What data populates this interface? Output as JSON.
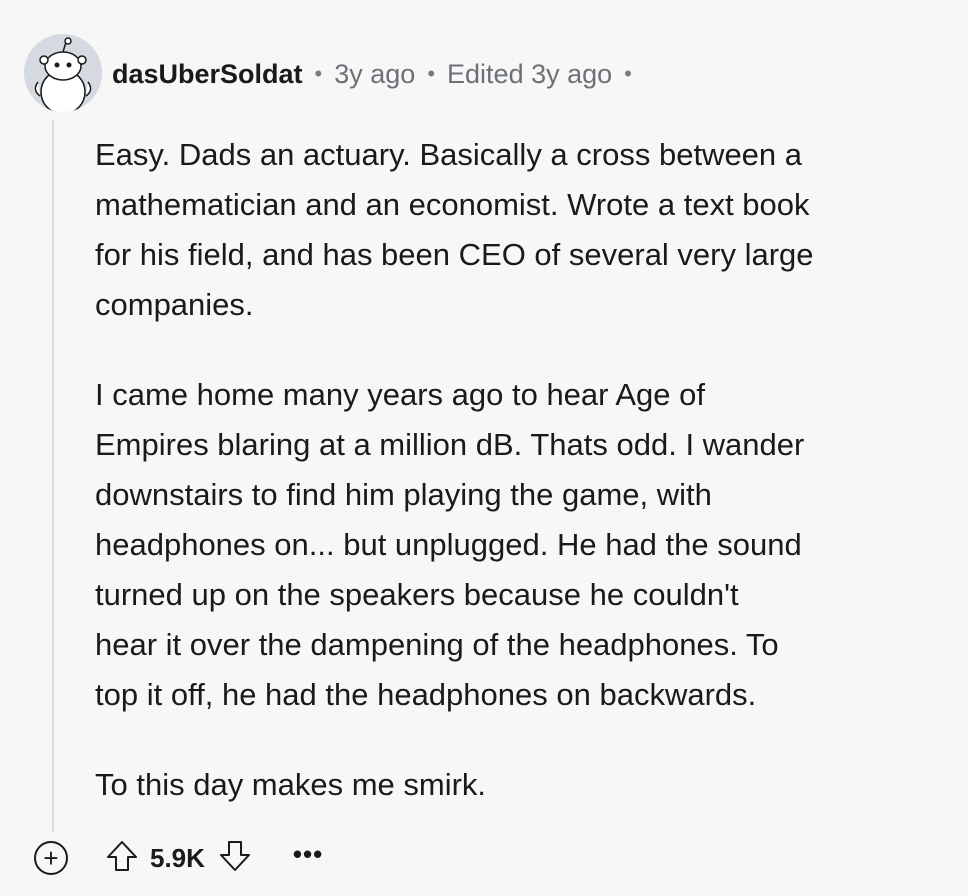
{
  "comment": {
    "username": "dasUberSoldat",
    "separator": "•",
    "posted_time": "3y ago",
    "edited_label": "Edited 3y ago",
    "paragraphs": [
      "Easy. Dads an actuary. Basically a cross between a\nmathematician and an economist. Wrote a text book\nfor his field, and has been CEO of several very large\ncompanies.",
      "I came home many years ago to hear Age of\nEmpires blaring at a million dB. Thats odd. I wander\ndownstairs to find him playing the game, with\nheadphones on... but unplugged. He had the sound\nturned up on the speakers because he couldn't\nhear it over the dampening of the headphones. To\ntop it off, he had the headphones on backwards.",
      "To this day makes me smirk."
    ]
  },
  "actions": {
    "expand_label": "+",
    "vote_count": "5.9K",
    "more_label": "•••"
  },
  "icons": {
    "avatar": "reddit-snoo-avatar",
    "upvote": "arrow-up-icon",
    "downvote": "arrow-down-icon"
  }
}
